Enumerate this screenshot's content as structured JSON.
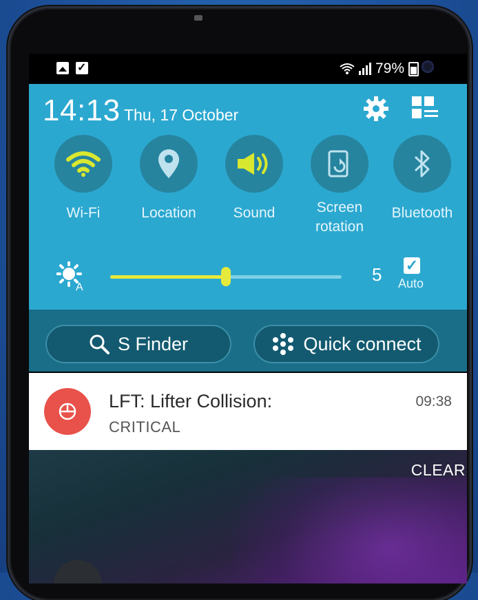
{
  "status_bar": {
    "left_icons": [
      "gallery-icon",
      "checkbox-icon"
    ],
    "signal": "wifi + signal",
    "battery": "79%"
  },
  "quick_panel": {
    "time": "14:13",
    "date": "Thu, 17 October",
    "tiles": [
      {
        "label": "Wi-Fi",
        "icon": "wifi-icon",
        "active": true
      },
      {
        "label": "Location",
        "icon": "location-icon",
        "active": false
      },
      {
        "label": "Sound",
        "icon": "sound-icon",
        "active": true
      },
      {
        "label": "Screen\nrotation",
        "icon": "screen-rotation-icon",
        "active": false
      },
      {
        "label": "Bluetooth",
        "icon": "bluetooth-icon",
        "active": false
      }
    ],
    "brightness": {
      "value": "5",
      "level": 0.5,
      "auto_label": "Auto",
      "auto_checked": true
    }
  },
  "buttons": {
    "s_finder": "S Finder",
    "quick_connect": "Quick connect"
  },
  "notification": {
    "title": "LFT: Lifter Collision:",
    "subtitle": "CRITICAL",
    "time": "09:38",
    "icon_color": "#e8524a"
  },
  "clear_label": "CLEAR",
  "colors": {
    "panel": "#2ba8d0",
    "accent": "#e6ea3c",
    "tile_bg": "#26849f"
  }
}
